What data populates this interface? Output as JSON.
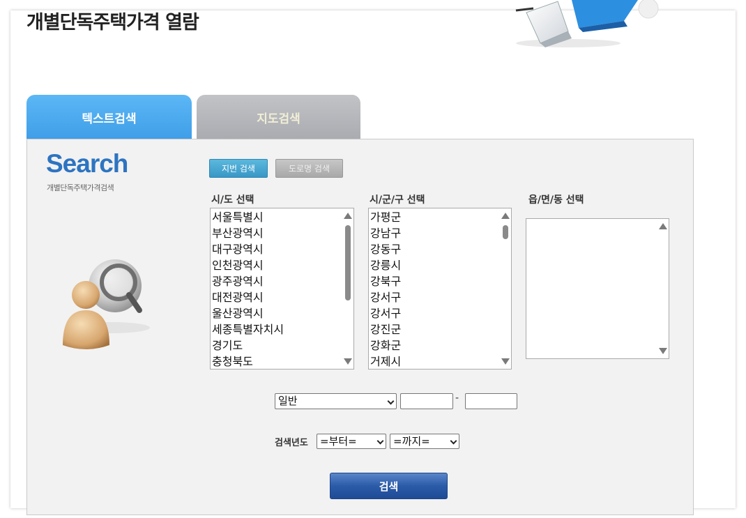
{
  "page": {
    "title": "개별단독주택가격 열람"
  },
  "tabs": [
    {
      "label": "텍스트검색",
      "active": true
    },
    {
      "label": "지도검색",
      "active": false
    }
  ],
  "search_box": {
    "logo_text": "Search",
    "logo_subtitle": "개별단독주택가격검색",
    "mode_buttons": {
      "jibun": "지번 검색",
      "road": "도로명 검색"
    },
    "columns": {
      "sido": {
        "label": "시/도 선택",
        "options": [
          "서울특별시",
          "부산광역시",
          "대구광역시",
          "인천광역시",
          "광주광역시",
          "대전광역시",
          "울산광역시",
          "세종특별자치시",
          "경기도",
          "충청북도"
        ]
      },
      "sigungu": {
        "label": "시/군/구 선택",
        "options": [
          "가평군",
          "강남구",
          "강동구",
          "강릉시",
          "강북구",
          "강서구",
          "강서구",
          "강진군",
          "강화군",
          "거제시"
        ]
      },
      "eupmyeondong": {
        "label": "읍/면/동 선택",
        "options": []
      }
    },
    "lot_type": {
      "selected": "일반",
      "from_value": "",
      "to_value": "",
      "separator": "-"
    },
    "year": {
      "label": "검색년도",
      "from": "=부터=",
      "to": "=까지="
    },
    "submit_label": "검색"
  },
  "colors": {
    "active_tab": "#4aa8ee",
    "inactive_tab": "#b5b7bb",
    "logo_blue": "#2d74c1",
    "submit_button": "#2b5ba8"
  }
}
